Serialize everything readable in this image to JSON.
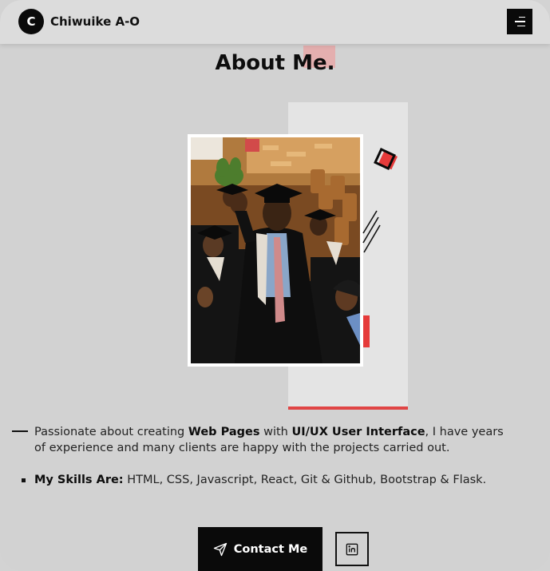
{
  "header": {
    "logo_letter": "C",
    "brand_name": "Chiwuike A-O",
    "menu_icon": "hamburger-menu-icon"
  },
  "about": {
    "title": "About Me.",
    "photo_alt": "graduation-photo",
    "intro": {
      "part1": "Passionate about creating ",
      "bold1": "Web Pages",
      "part2": " with ",
      "bold2": "UI/UX User Interface",
      "part3": ", I have years of experience and many clients are happy with the projects carried out."
    },
    "skills": {
      "label": "My Skills Are:",
      "value": " HTML, CSS, Javascript, React, Git & Github, Bootstrap & Flask."
    }
  },
  "actions": {
    "contact_label": "Contact Me",
    "contact_icon": "send-icon",
    "linkedin_icon": "linkedin-icon"
  },
  "colors": {
    "accent_red": "#e53a3a",
    "dark": "#0a0a0a",
    "background": "#d2d2d2"
  }
}
